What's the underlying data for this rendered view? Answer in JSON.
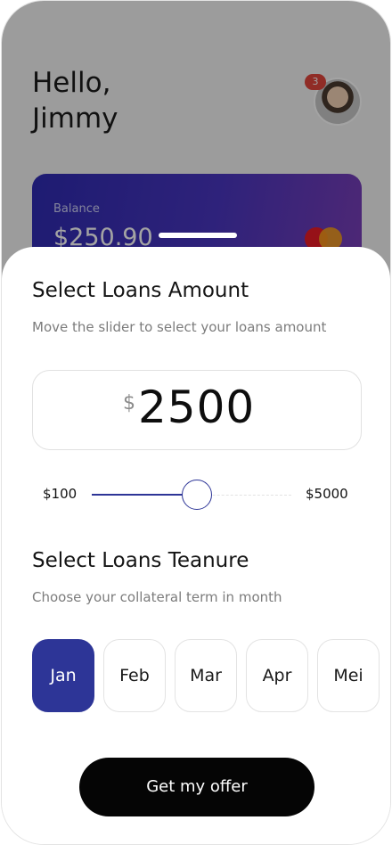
{
  "header": {
    "greeting": "Hello,",
    "name": "Jimmy",
    "notification_count": "3",
    "avatar_icon": "user-avatar"
  },
  "balance_card": {
    "label": "Balance",
    "value": "$250.90",
    "card_brand_icon": "mastercard-icon"
  },
  "loan_amount": {
    "title": "Select Loans Amount",
    "subtitle": "Move the slider to select your loans amount",
    "currency": "$",
    "value": "2500",
    "slider": {
      "min_label": "$100",
      "max_label": "$5000",
      "min": 100,
      "max": 5000,
      "current": 2500
    }
  },
  "tenure": {
    "title": "Select Loans Teanure",
    "subtitle": "Choose your collateral term in month",
    "months": [
      "Jan",
      "Feb",
      "Mar",
      "Apr",
      "Mei"
    ],
    "selected_index": 0
  },
  "cta": {
    "label": "Get my offer"
  },
  "colors": {
    "accent": "#2d3597",
    "button_bg": "#050505",
    "badge": "#e2453c",
    "card_gradient_start": "#2f2bb3",
    "card_gradient_end": "#7a3eb8"
  }
}
